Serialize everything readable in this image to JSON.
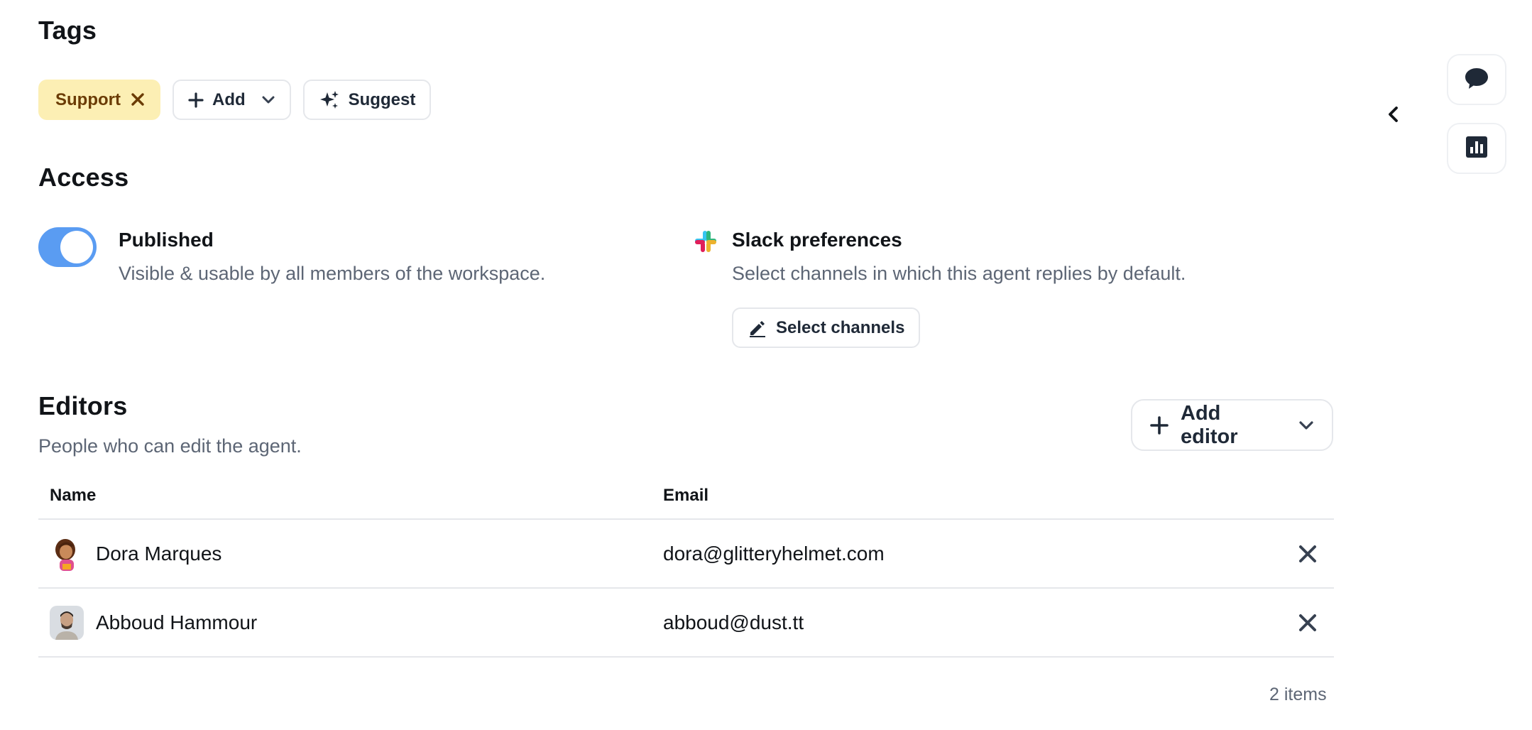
{
  "tags": {
    "title": "Tags",
    "chips": [
      {
        "label": "Support"
      }
    ],
    "add_label": "Add",
    "suggest_label": "Suggest"
  },
  "access": {
    "title": "Access",
    "published": {
      "label": "Published",
      "description": "Visible & usable by all members of the workspace.",
      "enabled": true
    },
    "slack": {
      "label": "Slack preferences",
      "description": "Select channels in which this agent replies by default.",
      "button_label": "Select channels"
    }
  },
  "editors": {
    "title": "Editors",
    "subtitle": "People who can edit the agent.",
    "add_button_label": "Add editor",
    "columns": [
      "Name",
      "Email"
    ],
    "rows": [
      {
        "name": "Dora Marques",
        "email": "dora@glitteryhelmet.com",
        "avatar": "dora-avatar"
      },
      {
        "name": "Abboud Hammour",
        "email": "abboud@dust.tt",
        "avatar": "person-avatar"
      }
    ],
    "count_label": "2 items"
  },
  "sidebar_actions": {
    "icons": [
      "chat-bubble-icon",
      "bar-chart-icon",
      "chevron-left-icon"
    ]
  },
  "colors": {
    "toggle_on": "#5a9cf2",
    "tag_bg": "#fcefb4",
    "tag_text": "#6b3c05",
    "muted_text": "#5d6675",
    "border": "#e5e7eb"
  }
}
